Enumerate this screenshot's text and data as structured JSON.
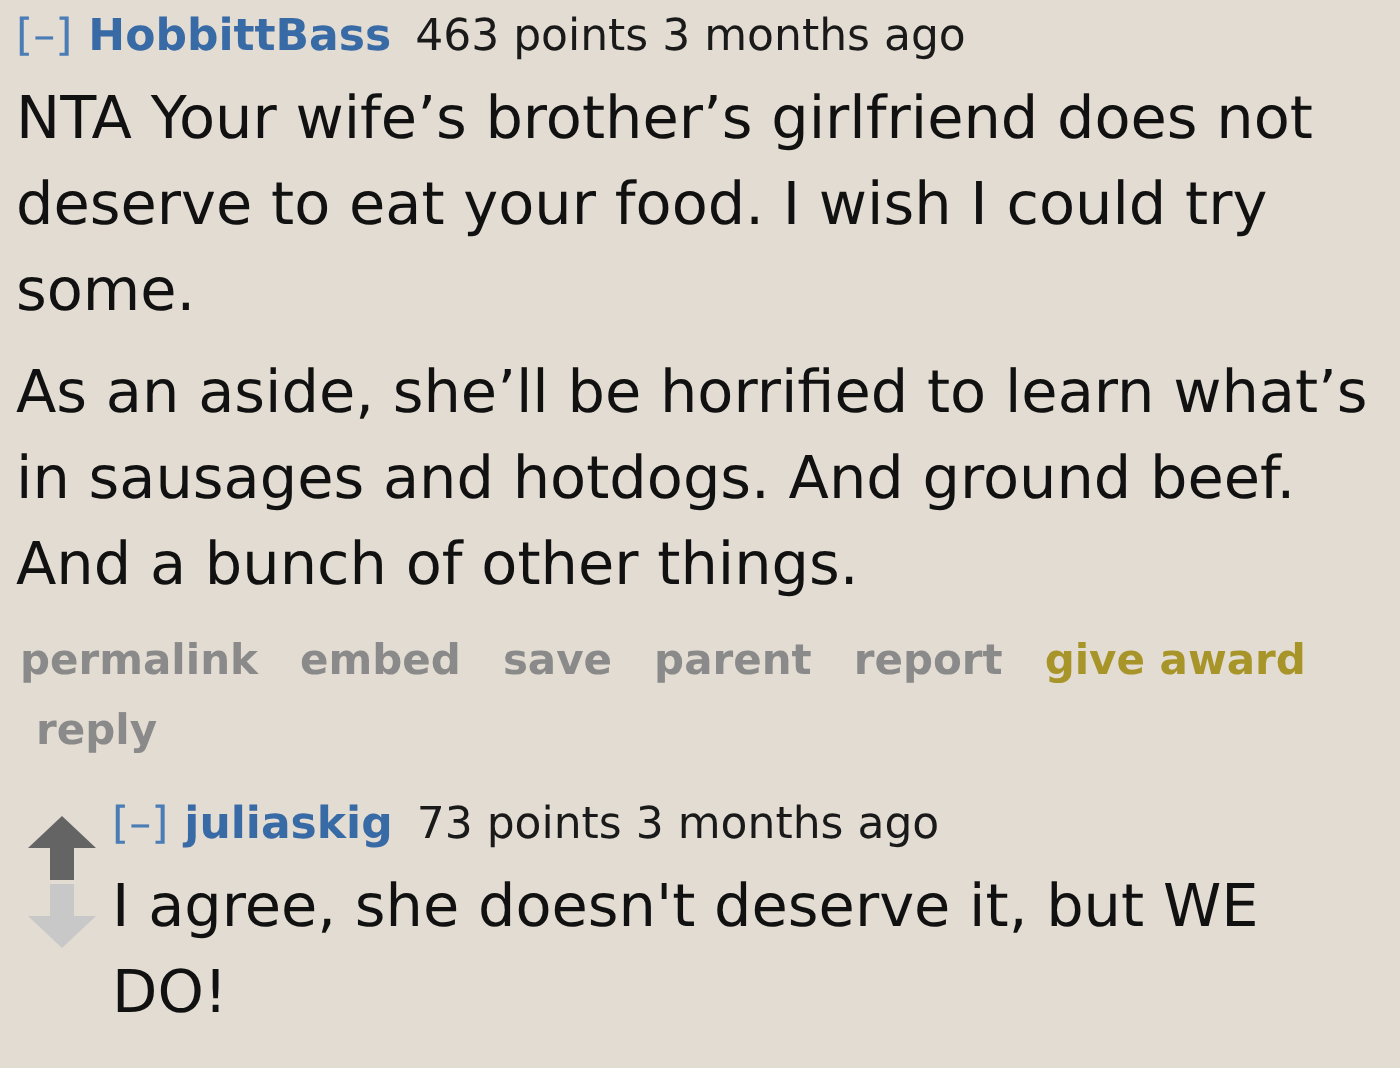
{
  "comments": [
    {
      "collapse": "[–]",
      "author": "HobbittBass",
      "meta": "463 points 3 months ago",
      "votes": false,
      "paragraphs": [
        "NTA Your wife’s brother’s girlfriend does not deserve to eat your food. I wish I could try some.",
        "As an aside, she’ll be horrified to learn what’s in sausages and hotdogs. And ground beef. And a bunch of other things."
      ],
      "links": [
        {
          "label": "permalink",
          "kind": "plain"
        },
        {
          "label": "embed",
          "kind": "plain"
        },
        {
          "label": "save",
          "kind": "plain"
        },
        {
          "label": "parent",
          "kind": "plain"
        },
        {
          "label": "report",
          "kind": "plain"
        },
        {
          "label": "give award",
          "kind": "award"
        },
        {
          "label": "reply",
          "kind": "plain"
        }
      ]
    },
    {
      "collapse": "[–]",
      "author": "juliaskig",
      "meta": "73 points 3 months ago",
      "votes": true,
      "paragraphs": [
        "I agree, she doesn't deserve it, but WE DO!"
      ]
    }
  ]
}
